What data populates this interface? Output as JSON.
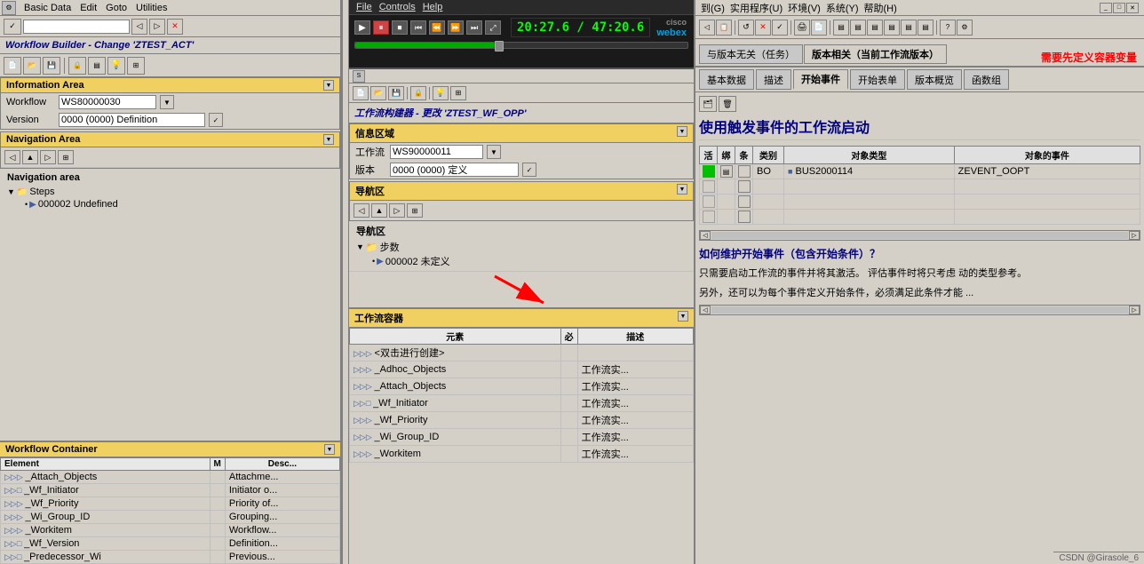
{
  "app": {
    "title_left": "Workflow Builder - Change 'ZTEST_ACT'",
    "title_middle": "工作流构建器 - 更改 'ZTEST_WF_OPP'",
    "required_note": "需要先定义容器变量"
  },
  "menus_left": {
    "items": [
      "Basic Data",
      "Edit",
      "Goto",
      "Utilities",
      "File",
      "Controls",
      "Help"
    ]
  },
  "menus_right": {
    "items": [
      "到(G)",
      "实用程序(U)",
      "环境(V)",
      "系统(Y)",
      "帮助(H)"
    ]
  },
  "webex": {
    "timer": "20:27.6 / 47:20.6",
    "logo": "cisco\nwebex"
  },
  "info_area_left": {
    "header": "Information Area",
    "workflow_label": "Workflow",
    "workflow_value": "WS80000030",
    "version_label": "Version",
    "version_value": "0000 (0000) Definition"
  },
  "info_area_middle": {
    "header": "信息区域",
    "workflow_label": "工作流",
    "workflow_value": "WS90000011",
    "version_label": "版本",
    "version_value": "0000 (0000) 定义"
  },
  "navigation_left": {
    "header": "Navigation Area",
    "nav_header2": "Navigation area",
    "steps_label": "Steps",
    "step_item": "000002 Undefined"
  },
  "navigation_middle": {
    "header": "导航区",
    "nav_header2": "导航区",
    "steps_label": "步数",
    "step_item": "000002 未定义"
  },
  "workflow_container_left": {
    "header": "Workflow Container",
    "col_element": "Element",
    "col_m": "M",
    "col_desc": "Desc...",
    "items": [
      {
        "icon": "▷▷▷",
        "name": "_Attach_Objects",
        "m": "",
        "desc": "Attachme..."
      },
      {
        "icon": "▷▷□",
        "name": "_Wf_Initiator",
        "m": "",
        "desc": "Initiator o..."
      },
      {
        "icon": "▷▷▷",
        "name": "_Wf_Priority",
        "m": "",
        "desc": "Priority of..."
      },
      {
        "icon": "▷▷▷",
        "name": "_Wi_Group_ID",
        "m": "",
        "desc": "Grouping..."
      },
      {
        "icon": "▷▷▷",
        "name": "_Workitem",
        "m": "",
        "desc": "Workflow..."
      },
      {
        "icon": "▷▷□",
        "name": "_Wf_Version",
        "m": "",
        "desc": "Definition..."
      },
      {
        "icon": "▷▷□",
        "name": "_Predecessor_Wi",
        "m": "",
        "desc": "Previous..."
      }
    ]
  },
  "workflow_container_middle": {
    "header": "工作流容器",
    "col_element": "元素",
    "col_m": "必",
    "col_desc": "描述",
    "items": [
      {
        "icon": "▷▷▷",
        "name": "<双击进行创建>",
        "m": "",
        "desc": ""
      },
      {
        "icon": "▷▷▷",
        "name": "_Adhoc_Objects",
        "m": "",
        "desc": "工作流实..."
      },
      {
        "icon": "▷▷▷",
        "name": "_Attach_Objects",
        "m": "",
        "desc": "工作流实..."
      },
      {
        "icon": "▷▷□",
        "name": "_Wf_Initiator",
        "m": "",
        "desc": "工作流实..."
      },
      {
        "icon": "▷▷▷",
        "name": "_Wf_Priority",
        "m": "",
        "desc": "工作流实..."
      },
      {
        "icon": "▷▷▷",
        "name": "_Wi_Group_ID",
        "m": "",
        "desc": "工作流实..."
      },
      {
        "icon": "▷▷▷",
        "name": "_Workitem",
        "m": "",
        "desc": "工作流实..."
      }
    ]
  },
  "right_panel": {
    "top_tabs": [
      "与版本无关（任务）",
      "版本相关（当前工作流版本）"
    ],
    "active_top_tab": 1,
    "bottom_tabs": [
      "基本数据",
      "描述",
      "开始事件",
      "开始表单",
      "版本概览",
      "函数组"
    ],
    "active_bottom_tab": 2,
    "section_title": "使用触发事件的工作流启动",
    "event_table": {
      "headers": [
        "活",
        "绑",
        "条",
        "类别",
        "对象类型",
        "对象的事件"
      ],
      "rows": [
        {
          "active": true,
          "bind": true,
          "cond": false,
          "type": "BO",
          "obj_type": "BUS2000114",
          "event": "ZEVENT_OOPT"
        },
        {
          "active": false,
          "bind": false,
          "cond": false,
          "type": "",
          "obj_type": "",
          "event": ""
        },
        {
          "active": false,
          "bind": false,
          "cond": false,
          "type": "",
          "obj_type": "",
          "event": ""
        },
        {
          "active": false,
          "bind": false,
          "cond": false,
          "type": "",
          "obj_type": "",
          "event": ""
        }
      ]
    },
    "desc_text1": "如何维护开始事件（包含开始条件）？",
    "desc_text2": "只需要启动工作流的事件并将其激活。   评估事件时将只考虑\n动的类型参考。",
    "desc_text3": "另外，还可以为每个事件定义开始条件，必须满足此条件才能\n..."
  },
  "status_bar": {
    "text": "CSDN @Girasole_6"
  }
}
